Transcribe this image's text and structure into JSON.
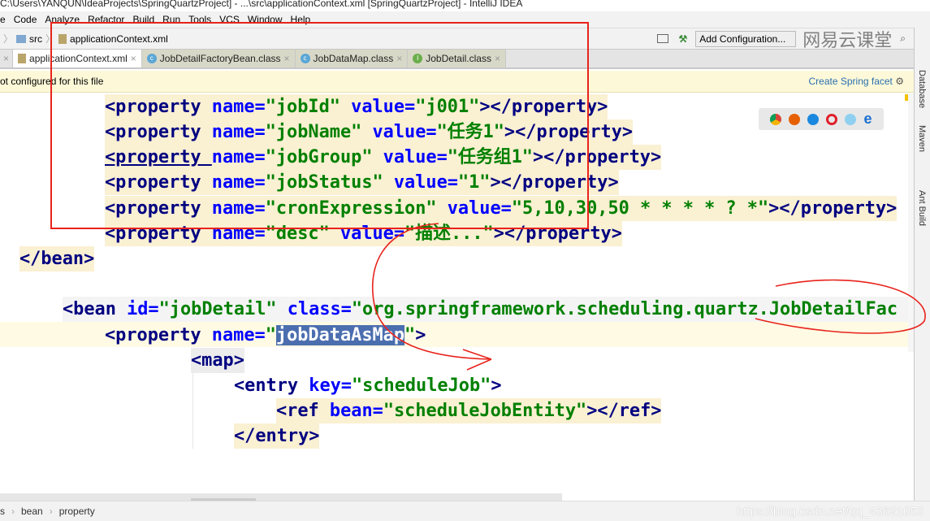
{
  "window": {
    "title": "C:\\Users\\YANQUN\\IdeaProjects\\SpringQuartzProject] - ...\\src\\applicationContext.xml [SpringQuartzProject] - IntelliJ IDEA"
  },
  "menu": [
    "e",
    "Code",
    "Analyze",
    "Refactor",
    "Build",
    "Run",
    "Tools",
    "VCS",
    "Window",
    "Help"
  ],
  "breadcrumb": {
    "folder": "src",
    "file": "applicationContext.xml"
  },
  "toolbar": {
    "run_config": "Add Configuration..."
  },
  "watermark": "网易云课堂",
  "tabs": [
    {
      "label": "applicationContext.xml",
      "icon": "xml-file-icon",
      "active": true
    },
    {
      "label": "JobDetailFactoryBean.class",
      "icon": "class-icon"
    },
    {
      "label": "JobDataMap.class",
      "icon": "class-icon"
    },
    {
      "label": "JobDetail.class",
      "icon": "interface-icon"
    }
  ],
  "banner": {
    "message": "ot configured for this file",
    "action": "Create Spring facet"
  },
  "side_tools": [
    "Database",
    "Maven",
    "Ant Build"
  ],
  "code": {
    "l1": [
      "<property ",
      "name=",
      "\"jobId\"",
      " value=",
      "\"j001\"",
      "></property>"
    ],
    "l2": [
      "<property ",
      "name=",
      "\"jobName\"",
      " value=",
      "\"任务1\"",
      "></property>"
    ],
    "l3": [
      "<property ",
      "name=",
      "\"jobGroup\"",
      " value=",
      "\"任务组1\"",
      "></property>"
    ],
    "l4": [
      "<property ",
      "name=",
      "\"jobStatus\"",
      " value=",
      "\"1\"",
      "></property>"
    ],
    "l5": [
      "<property ",
      "name=",
      "\"cronExpression\"",
      " value=",
      "\"5,10,30,50 * * * * ? *\"",
      "></property>"
    ],
    "l6": [
      "<property ",
      "name=",
      "\"desc\"",
      " value=",
      "\"描述...\"",
      "></property>"
    ],
    "l7": "</bean>",
    "l8": [
      "<bean ",
      "id=",
      "\"jobDetail\"",
      " class=",
      "\"org.springframework.scheduling.quartz.JobDetailFac"
    ],
    "l9": [
      "<property ",
      "name=",
      "\"",
      "jobDataAsMap",
      "\"",
      ">"
    ],
    "l10": "<map>",
    "l11": [
      "<entry ",
      "key=",
      "\"scheduleJob\"",
      ">"
    ],
    "l12": [
      "<ref ",
      "bean=",
      "\"scheduleJobEntity\"",
      "></ref>"
    ],
    "l13": "</entry>"
  },
  "status": {
    "crumbs": [
      "s",
      "bean",
      "property"
    ]
  },
  "credit": "https://blog.csdn.net/qq_43621053",
  "colors": {
    "tag": "#000080",
    "attr": "#0000ff",
    "value": "#008000",
    "annotation": "#e8231b",
    "selection": "#4b6eaf"
  }
}
